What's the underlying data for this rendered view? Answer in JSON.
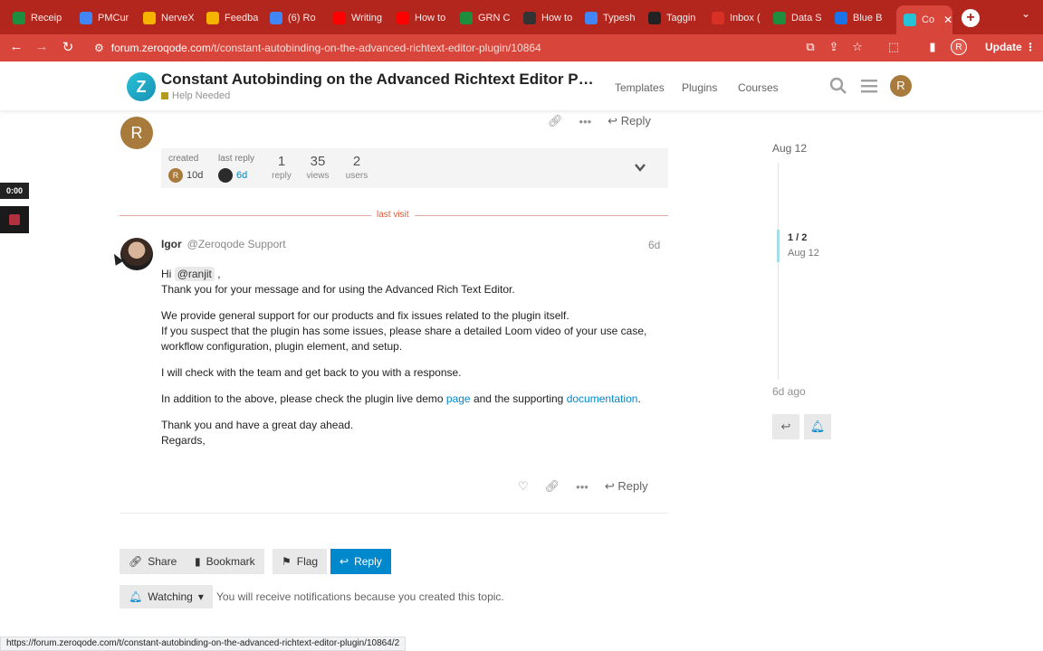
{
  "browser": {
    "tabs": [
      {
        "label": "Receip",
        "color": "#1e8e3e"
      },
      {
        "label": "PMCur",
        "color": "#4285f4"
      },
      {
        "label": "NerveX",
        "color": "#f4b400"
      },
      {
        "label": "Feedba",
        "color": "#f4b400"
      },
      {
        "label": "(6) Ro",
        "color": "#4285f4"
      },
      {
        "label": "Writing",
        "color": "#ff0000"
      },
      {
        "label": "How to",
        "color": "#ff0000"
      },
      {
        "label": "GRN C",
        "color": "#1e8e3e"
      },
      {
        "label": "How to",
        "color": "#333333"
      },
      {
        "label": "Typesh",
        "color": "#4285f4"
      },
      {
        "label": "Taggin",
        "color": "#222222"
      },
      {
        "label": "Inbox (",
        "color": "#d93025"
      },
      {
        "label": "Data S",
        "color": "#1e8e3e"
      },
      {
        "label": "Blue B",
        "color": "#1a73e8"
      },
      {
        "label": "Co",
        "color": "#27c2d6"
      }
    ],
    "url_host": "forum.zeroqode.com",
    "url_path": "/t/constant-autobinding-on-the-advanced-richtext-editor-plugin/10864",
    "profile_initial": "R",
    "update_label": "Update",
    "status_url": "https://forum.zeroqode.com/t/constant-autobinding-on-the-advanced-richtext-editor-plugin/10864/2"
  },
  "header": {
    "logo_letter": "Z",
    "title": "Constant Autobinding on the Advanced Richtext Editor Plugin",
    "category": "Help Needed",
    "category_color": "#b39b1e",
    "nav": [
      "Templates",
      "Plugins",
      "Courses"
    ],
    "user_initial": "R"
  },
  "first_post": {
    "avatar_initial": "R",
    "reply_label": "Reply",
    "map": {
      "created_label": "created",
      "created_value": "10d",
      "last_reply_label": "last reply",
      "last_reply_value": "6d",
      "replies_value": "1",
      "replies_label": "reply",
      "views_value": "35",
      "views_label": "views",
      "users_value": "2",
      "users_label": "users"
    }
  },
  "last_visit_label": "last visit",
  "post": {
    "author_name": "Igor",
    "author_handle": "@Zeroqode Support",
    "date": "6d",
    "greeting": "Hi",
    "mention": "@ranjit",
    "line1": "Thank you for your message and for using the Advanced Rich Text Editor.",
    "para2_a": "We provide general support for our products and fix issues related to the plugin itself.",
    "para2_b": "If you suspect that the plugin has some issues, please share a detailed Loom video of your use case, workflow configuration, plugin element, and setup.",
    "para3": "I will check with the team and get back to you with a response.",
    "para4_a": "In addition to the above, please check the plugin live demo",
    "para4_link1": "page",
    "para4_b": "and the supporting",
    "para4_link2": "documentation",
    "para5": "Thank you and have a great day ahead.",
    "para6": "Regards,",
    "reply_label": "Reply"
  },
  "footer": {
    "share_label": "Share",
    "bookmark_label": "Bookmark",
    "flag_label": "Flag",
    "reply_label": "Reply",
    "watching_label": "Watching",
    "watching_note": "You will receive notifications because you created this topic."
  },
  "timeline": {
    "top_date": "Aug 12",
    "position": "1 / 2",
    "position_date": "Aug 12",
    "bottom": "6d ago"
  },
  "recorder": {
    "timer": "0:00"
  }
}
